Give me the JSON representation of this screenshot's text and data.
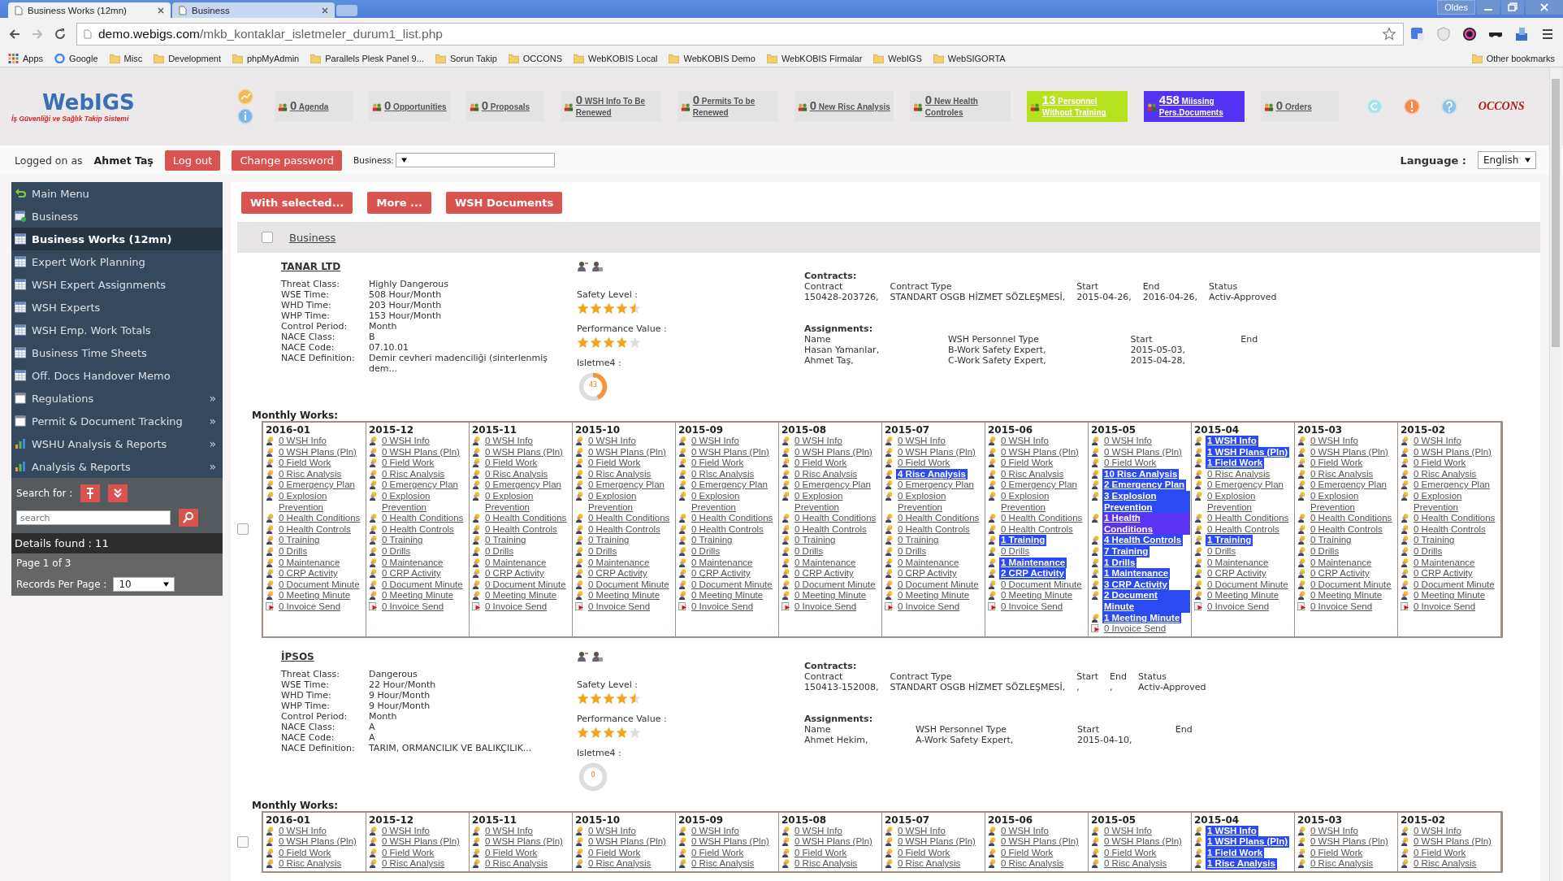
{
  "browser": {
    "tabs": [
      {
        "title": "Business Works (12mn)",
        "selected": true
      },
      {
        "title": "Business",
        "selected": false
      }
    ],
    "profile": "Oldes",
    "url_domain": "demo.webigs.com",
    "url_path": "/mkb_kontaklar_isletmeler_durum1_list.php",
    "bookmarks": [
      "Apps",
      "Google",
      "Misc",
      "Development",
      "phpMyAdmin",
      "Parallels Plesk Panel 9...",
      "Sorun Takip",
      "OCCONS",
      "WebKOBIS Local",
      "WebKOBIS Demo",
      "WebKOBIS Firmalar",
      "WebIGS",
      "WebSIGORTA"
    ],
    "other_bookmarks": "Other bookmarks"
  },
  "logo": {
    "name": "WebIGS",
    "tagline": "İş Güvenliği ve Sağlık Takip Sistemi"
  },
  "widgets": [
    {
      "count": "0",
      "label": "Agenda",
      "color": "#e3e3e3"
    },
    {
      "count": "0",
      "label": "Opportunities",
      "color": "#e3e3e3"
    },
    {
      "count": "0",
      "label": "Proposals",
      "color": "#e3e3e3"
    },
    {
      "count": "0",
      "label": "WSH Info To Be Renewed",
      "color": "#e3e3e3"
    },
    {
      "count": "0",
      "label": "Permits To be Renewed",
      "color": "#e3e3e3"
    },
    {
      "count": "0",
      "label": "New Risc Analysis",
      "color": "#e3e3e3"
    },
    {
      "count": "0",
      "label": "New Health Controles",
      "color": "#e3e3e3"
    },
    {
      "count": "13",
      "label": "Personnel Without Training",
      "color": "#b6e21f"
    },
    {
      "count": "458",
      "label": "Miissing Pers.Documents",
      "color": "#5533f5"
    },
    {
      "count": "0",
      "label": "Orders",
      "color": "#e3e3e3"
    }
  ],
  "partner_logo": "OCCONS",
  "login": {
    "prefix": "Logged on as",
    "user": "Ahmet Taş",
    "logout": "Log out",
    "change_password": "Change password",
    "business_label": "Business:",
    "language_label": "Language :",
    "language": "English"
  },
  "sidebar": {
    "items": [
      {
        "label": "Main Menu",
        "kind": "back",
        "selected": false
      },
      {
        "label": "Business",
        "kind": "add",
        "selected": false
      },
      {
        "label": "Business Works (12mn)",
        "kind": "table",
        "selected": true
      },
      {
        "label": "Expert Work Planning",
        "kind": "table",
        "selected": false
      },
      {
        "label": "WSH Expert Assignments",
        "kind": "table",
        "selected": false
      },
      {
        "label": "WSH Experts",
        "kind": "table",
        "selected": false
      },
      {
        "label": "WSH Emp. Work Totals",
        "kind": "table",
        "selected": false
      },
      {
        "label": "Business Time Sheets",
        "kind": "table",
        "selected": false
      },
      {
        "label": "Off. Docs Handover Memo",
        "kind": "table",
        "selected": false
      },
      {
        "label": "Regulations",
        "kind": "page",
        "selected": false,
        "arrow": "»"
      },
      {
        "label": "Permit & Document Tracking",
        "kind": "page",
        "selected": false,
        "arrow": "»"
      },
      {
        "label": "WSHU Analysis & Reports",
        "kind": "chart",
        "selected": false,
        "arrow": "»"
      },
      {
        "label": "Analysis & Reports",
        "kind": "chart",
        "selected": false,
        "arrow": "»"
      }
    ],
    "search_label": "Search for :",
    "search_placeholder": "search",
    "details": "Details found : 11",
    "page": "Page 1 of 3",
    "per_page_label": "Records Per Page :",
    "per_page": "10"
  },
  "actions": [
    "With selected...",
    "More ...",
    "WSH Documents"
  ],
  "list_header": "Business",
  "list_checked": false,
  "businesses": [
    {
      "name": "TANAR LTD",
      "fields": [
        {
          "label": "Threat Class:",
          "value": "Highly Dangerous"
        },
        {
          "label": "WSE Time:",
          "value": "508 Hour/Month"
        },
        {
          "label": "WHD Time:",
          "value": "203 Hour/Month"
        },
        {
          "label": "WHP Time:",
          "value": "153 Hour/Month"
        },
        {
          "label": "Control Period:",
          "value": "Month"
        },
        {
          "label": "NACE Class:",
          "value": "B"
        },
        {
          "label": "NACE Code:",
          "value": "07.10.01"
        },
        {
          "label": "NACE Definition:",
          "value": "Demir cevheri madenciliği (sinterlenmiş dem..."
        }
      ],
      "safety_label": "Safety Level :",
      "safety": {
        "stars": 4.5
      },
      "performance_label": "Performance Value :",
      "performance": {
        "stars": 4
      },
      "donut_label": "Isletme4 :",
      "donut": {
        "value": "43",
        "level": 0.43
      },
      "contracts": {
        "title": "Contracts:",
        "columns": [
          "Contract",
          "Contract Type",
          "Start",
          "End",
          "Status"
        ],
        "rows": [
          [
            "150428-203726,",
            "STANDART OSGB HİZMET SÖZLEŞMESİ,",
            "2015-04-26,",
            "2016-04-26,",
            "Activ-Approved"
          ]
        ]
      },
      "assignments": {
        "title": "Assignments:",
        "columns": [
          "Name",
          "WSH Personnel Type",
          "Start",
          "End"
        ],
        "rows": [
          [
            "Hasan Yamanlar,",
            "B-Work Safety Expert,",
            "2015-05-03,"
          ],
          [
            "Ahmet Taş,",
            "C-Work Safety Expert,",
            "2015-04-28,"
          ]
        ]
      },
      "works_label": "Monthly Works:",
      "checked": false,
      "months": [
        {
          "label": "2016-01",
          "items": [
            {
              "text": "0 WSH Info",
              "highlighted": false
            },
            {
              "text": "0 WSH Plans (Pln)",
              "highlighted": false
            },
            {
              "text": "0 Field Work",
              "highlighted": false
            },
            {
              "text": "0 Risc Analysis",
              "highlighted": false
            },
            {
              "text": "0 Emergency Plan",
              "highlighted": false
            },
            {
              "text": "0 Explosion Prevention",
              "highlighted": false
            },
            {
              "text": "0 Health Conditions",
              "highlighted": false
            },
            {
              "text": "0 Health Controls",
              "highlighted": false
            },
            {
              "text": "0 Training",
              "highlighted": false
            },
            {
              "text": "0 Drills",
              "highlighted": false
            },
            {
              "text": "0 Maintenance",
              "highlighted": false
            },
            {
              "text": "0 CRP Activity",
              "highlighted": false
            },
            {
              "text": "0 Document Minute",
              "highlighted": false
            },
            {
              "text": "0 Meeting Minute",
              "highlighted": false
            },
            {
              "text": "0 Invoice Send",
              "highlighted": false
            }
          ]
        },
        {
          "label": "2015-12",
          "items": [
            {
              "text": "0 WSH Info",
              "highlighted": false
            },
            {
              "text": "0 WSH Plans (Pln)",
              "highlighted": false
            },
            {
              "text": "0 Field Work",
              "highlighted": false
            },
            {
              "text": "0 Risc Analysis",
              "highlighted": false
            },
            {
              "text": "0 Emergency Plan",
              "highlighted": false
            },
            {
              "text": "0 Explosion Prevention",
              "highlighted": false
            },
            {
              "text": "0 Health Conditions",
              "highlighted": false
            },
            {
              "text": "0 Health Controls",
              "highlighted": false
            },
            {
              "text": "0 Training",
              "highlighted": false
            },
            {
              "text": "0 Drills",
              "highlighted": false
            },
            {
              "text": "0 Maintenance",
              "highlighted": false
            },
            {
              "text": "0 CRP Activity",
              "highlighted": false
            },
            {
              "text": "0 Document Minute",
              "highlighted": false
            },
            {
              "text": "0 Meeting Minute",
              "highlighted": false
            },
            {
              "text": "0 Invoice Send",
              "highlighted": false
            }
          ]
        },
        {
          "label": "2015-11",
          "items": [
            {
              "text": "0 WSH Info",
              "highlighted": false
            },
            {
              "text": "0 WSH Plans (Pln)",
              "highlighted": false
            },
            {
              "text": "0 Field Work",
              "highlighted": false
            },
            {
              "text": "0 Risc Analysis",
              "highlighted": false
            },
            {
              "text": "0 Emergency Plan",
              "highlighted": false
            },
            {
              "text": "0 Explosion Prevention",
              "highlighted": false
            },
            {
              "text": "0 Health Conditions",
              "highlighted": false
            },
            {
              "text": "0 Health Controls",
              "highlighted": false
            },
            {
              "text": "0 Training",
              "highlighted": false
            },
            {
              "text": "0 Drills",
              "highlighted": false
            },
            {
              "text": "0 Maintenance",
              "highlighted": false
            },
            {
              "text": "0 CRP Activity",
              "highlighted": false
            },
            {
              "text": "0 Document Minute",
              "highlighted": false
            },
            {
              "text": "0 Meeting Minute",
              "highlighted": false
            },
            {
              "text": "0 Invoice Send",
              "highlighted": false
            }
          ]
        },
        {
          "label": "2015-10",
          "items": [
            {
              "text": "0 WSH Info",
              "highlighted": false
            },
            {
              "text": "0 WSH Plans (Pln)",
              "highlighted": false
            },
            {
              "text": "0 Field Work",
              "highlighted": false
            },
            {
              "text": "0 Risc Analysis",
              "highlighted": false
            },
            {
              "text": "0 Emergency Plan",
              "highlighted": false
            },
            {
              "text": "0 Explosion Prevention",
              "highlighted": false
            },
            {
              "text": "0 Health Conditions",
              "highlighted": false
            },
            {
              "text": "0 Health Controls",
              "highlighted": false
            },
            {
              "text": "0 Training",
              "highlighted": false
            },
            {
              "text": "0 Drills",
              "highlighted": false
            },
            {
              "text": "0 Maintenance",
              "highlighted": false
            },
            {
              "text": "0 CRP Activity",
              "highlighted": false
            },
            {
              "text": "0 Document Minute",
              "highlighted": false
            },
            {
              "text": "0 Meeting Minute",
              "highlighted": false
            },
            {
              "text": "0 Invoice Send",
              "highlighted": false
            }
          ]
        },
        {
          "label": "2015-09",
          "items": [
            {
              "text": "0 WSH Info",
              "highlighted": false
            },
            {
              "text": "0 WSH Plans (Pln)",
              "highlighted": false
            },
            {
              "text": "0 Field Work",
              "highlighted": false
            },
            {
              "text": "0 Risc Analysis",
              "highlighted": false
            },
            {
              "text": "0 Emergency Plan",
              "highlighted": false
            },
            {
              "text": "0 Explosion Prevention",
              "highlighted": false
            },
            {
              "text": "0 Health Conditions",
              "highlighted": false
            },
            {
              "text": "0 Health Controls",
              "highlighted": false
            },
            {
              "text": "0 Training",
              "highlighted": false
            },
            {
              "text": "0 Drills",
              "highlighted": false
            },
            {
              "text": "0 Maintenance",
              "highlighted": false
            },
            {
              "text": "0 CRP Activity",
              "highlighted": false
            },
            {
              "text": "0 Document Minute",
              "highlighted": false
            },
            {
              "text": "0 Meeting Minute",
              "highlighted": false
            },
            {
              "text": "0 Invoice Send",
              "highlighted": false
            }
          ]
        },
        {
          "label": "2015-08",
          "items": [
            {
              "text": "0 WSH Info",
              "highlighted": false
            },
            {
              "text": "0 WSH Plans (Pln)",
              "highlighted": false
            },
            {
              "text": "0 Field Work",
              "highlighted": false
            },
            {
              "text": "0 Risc Analysis",
              "highlighted": false
            },
            {
              "text": "0 Emergency Plan",
              "highlighted": false
            },
            {
              "text": "0 Explosion Prevention",
              "highlighted": false
            },
            {
              "text": "0 Health Conditions",
              "highlighted": false
            },
            {
              "text": "0 Health Controls",
              "highlighted": false
            },
            {
              "text": "0 Training",
              "highlighted": false
            },
            {
              "text": "0 Drills",
              "highlighted": false
            },
            {
              "text": "0 Maintenance",
              "highlighted": false
            },
            {
              "text": "0 CRP Activity",
              "highlighted": false
            },
            {
              "text": "0 Document Minute",
              "highlighted": false
            },
            {
              "text": "0 Meeting Minute",
              "highlighted": false
            },
            {
              "text": "0 Invoice Send",
              "highlighted": false
            }
          ]
        },
        {
          "label": "2015-07",
          "items": [
            {
              "text": "0 WSH Info",
              "highlighted": false
            },
            {
              "text": "0 WSH Plans (Pln)",
              "highlighted": false
            },
            {
              "text": "0 Field Work",
              "highlighted": false
            },
            {
              "text": "4 Risc Analysis",
              "highlighted": true,
              "color": "#2b4bf2"
            },
            {
              "text": "0 Emergency Plan",
              "highlighted": false
            },
            {
              "text": "0 Explosion Prevention",
              "highlighted": false
            },
            {
              "text": "0 Health Conditions",
              "highlighted": false
            },
            {
              "text": "0 Health Controls",
              "highlighted": false
            },
            {
              "text": "0 Training",
              "highlighted": false
            },
            {
              "text": "0 Drills",
              "highlighted": false
            },
            {
              "text": "0 Maintenance",
              "highlighted": false
            },
            {
              "text": "0 CRP Activity",
              "highlighted": false
            },
            {
              "text": "0 Document Minute",
              "highlighted": false
            },
            {
              "text": "0 Meeting Minute",
              "highlighted": false
            },
            {
              "text": "0 Invoice Send",
              "highlighted": false
            }
          ]
        },
        {
          "label": "2015-06",
          "items": [
            {
              "text": "0 WSH Info",
              "highlighted": false
            },
            {
              "text": "0 WSH Plans (Pln)",
              "highlighted": false
            },
            {
              "text": "0 Field Work",
              "highlighted": false
            },
            {
              "text": "0 Risc Analysis",
              "highlighted": false
            },
            {
              "text": "0 Emergency Plan",
              "highlighted": false
            },
            {
              "text": "0 Explosion Prevention",
              "highlighted": false
            },
            {
              "text": "0 Health Conditions",
              "highlighted": false
            },
            {
              "text": "0 Health Controls",
              "highlighted": false
            },
            {
              "text": "1 Training",
              "highlighted": true,
              "color": "#2b4bf2"
            },
            {
              "text": "0 Drills",
              "highlighted": false
            },
            {
              "text": "1 Maintenance",
              "highlighted": true,
              "color": "#2b4bf2"
            },
            {
              "text": "2 CRP Activity",
              "highlighted": true,
              "color": "#2b4bf2"
            },
            {
              "text": "0 Document Minute",
              "highlighted": false
            },
            {
              "text": "0 Meeting Minute",
              "highlighted": false
            },
            {
              "text": "0 Invoice Send",
              "highlighted": false
            }
          ]
        },
        {
          "label": "2015-05",
          "items": [
            {
              "text": "0 WSH Info",
              "highlighted": false
            },
            {
              "text": "0 WSH Plans (Pln)",
              "highlighted": false
            },
            {
              "text": "0 Field Work",
              "highlighted": false
            },
            {
              "text": "10 Risc Analysis",
              "highlighted": true,
              "color": "#2b4bf2"
            },
            {
              "text": "2 Emergency Plan",
              "highlighted": true,
              "color": "#2b4bf2"
            },
            {
              "text": "3 Explosion Prevention",
              "highlighted": true,
              "color": "#2b4bf2"
            },
            {
              "text": "1 Health Conditions",
              "highlighted": true,
              "color": "#5a34f2"
            },
            {
              "text": "4 Health Controls",
              "highlighted": true,
              "color": "#2b4bf2"
            },
            {
              "text": "7 Training",
              "highlighted": true,
              "color": "#2b4bf2"
            },
            {
              "text": "1 Drills",
              "highlighted": true,
              "color": "#2b4bf2"
            },
            {
              "text": "1 Maintenance",
              "highlighted": true,
              "color": "#2b4bf2"
            },
            {
              "text": "3 CRP Activity",
              "highlighted": true,
              "color": "#2b4bf2"
            },
            {
              "text": "2 Document Minute",
              "highlighted": true,
              "color": "#2b4bf2"
            },
            {
              "text": "1 Meeting Minute",
              "highlighted": true,
              "color": "#2b4bf2"
            },
            {
              "text": "0 Invoice Send",
              "highlighted": false
            }
          ]
        },
        {
          "label": "2015-04",
          "items": [
            {
              "text": "1 WSH Info",
              "highlighted": true,
              "color": "#2b4bf2"
            },
            {
              "text": "1 WSH Plans (Pln)",
              "highlighted": true,
              "color": "#2b4bf2"
            },
            {
              "text": "1 Field Work",
              "highlighted": true,
              "color": "#2b4bf2"
            },
            {
              "text": "0 Risc Analysis",
              "highlighted": false
            },
            {
              "text": "0 Emergency Plan",
              "highlighted": false
            },
            {
              "text": "0 Explosion Prevention",
              "highlighted": false
            },
            {
              "text": "0 Health Conditions",
              "highlighted": false
            },
            {
              "text": "0 Health Controls",
              "highlighted": false
            },
            {
              "text": "1 Training",
              "highlighted": true,
              "color": "#2b4bf2"
            },
            {
              "text": "0 Drills",
              "highlighted": false
            },
            {
              "text": "0 Maintenance",
              "highlighted": false
            },
            {
              "text": "0 CRP Activity",
              "highlighted": false
            },
            {
              "text": "0 Document Minute",
              "highlighted": false
            },
            {
              "text": "0 Meeting Minute",
              "highlighted": false
            },
            {
              "text": "0 Invoice Send",
              "highlighted": false
            }
          ]
        },
        {
          "label": "2015-03",
          "items": [
            {
              "text": "0 WSH Info",
              "highlighted": false
            },
            {
              "text": "0 WSH Plans (Pln)",
              "highlighted": false
            },
            {
              "text": "0 Field Work",
              "highlighted": false
            },
            {
              "text": "0 Risc Analysis",
              "highlighted": false
            },
            {
              "text": "0 Emergency Plan",
              "highlighted": false
            },
            {
              "text": "0 Explosion Prevention",
              "highlighted": false
            },
            {
              "text": "0 Health Conditions",
              "highlighted": false
            },
            {
              "text": "0 Health Controls",
              "highlighted": false
            },
            {
              "text": "0 Training",
              "highlighted": false
            },
            {
              "text": "0 Drills",
              "highlighted": false
            },
            {
              "text": "0 Maintenance",
              "highlighted": false
            },
            {
              "text": "0 CRP Activity",
              "highlighted": false
            },
            {
              "text": "0 Document Minute",
              "highlighted": false
            },
            {
              "text": "0 Meeting Minute",
              "highlighted": false
            },
            {
              "text": "0 Invoice Send",
              "highlighted": false
            }
          ]
        },
        {
          "label": "2015-02",
          "items": [
            {
              "text": "0 WSH Info",
              "highlighted": false
            },
            {
              "text": "0 WSH Plans (Pln)",
              "highlighted": false
            },
            {
              "text": "0 Field Work",
              "highlighted": false
            },
            {
              "text": "0 Risc Analysis",
              "highlighted": false
            },
            {
              "text": "0 Emergency Plan",
              "highlighted": false
            },
            {
              "text": "0 Explosion Prevention",
              "highlighted": false
            },
            {
              "text": "0 Health Conditions",
              "highlighted": false
            },
            {
              "text": "0 Health Controls",
              "highlighted": false
            },
            {
              "text": "0 Training",
              "highlighted": false
            },
            {
              "text": "0 Drills",
              "highlighted": false
            },
            {
              "text": "0 Maintenance",
              "highlighted": false
            },
            {
              "text": "0 CRP Activity",
              "highlighted": false
            },
            {
              "text": "0 Document Minute",
              "highlighted": false
            },
            {
              "text": "0 Meeting Minute",
              "highlighted": false
            },
            {
              "text": "0 Invoice Send",
              "highlighted": false
            }
          ]
        }
      ]
    },
    {
      "name": "İPSOS",
      "fields": [
        {
          "label": "Threat Class:",
          "value": "Dangerous"
        },
        {
          "label": "WSE Time:",
          "value": "22 Hour/Month"
        },
        {
          "label": "WHD Time:",
          "value": "9 Hour/Month"
        },
        {
          "label": "WHP Time:",
          "value": "9 Hour/Month"
        },
        {
          "label": "Control Period:",
          "value": "Month"
        },
        {
          "label": "NACE Class:",
          "value": "A"
        },
        {
          "label": "NACE Code:",
          "value": "A"
        },
        {
          "label": "NACE Definition:",
          "value": "TARIM, ORMANCILIK VE BALIKÇILIK..."
        }
      ],
      "safety_label": "Safety Level :",
      "safety": {
        "stars": 4.5
      },
      "performance_label": "Performance Value :",
      "performance": {
        "stars": 4
      },
      "donut_label": "Isletme4 :",
      "donut": {
        "value": "0",
        "level": 0
      },
      "contracts": {
        "title": "Contracts:",
        "columns": [
          "Contract",
          "Contract Type",
          "Start",
          "End",
          "Status"
        ],
        "rows": [
          [
            "150413-152008,",
            "STANDART OSGB HİZMET SÖZLEŞMESİ,",
            ",",
            ",",
            "Activ-Approved"
          ]
        ]
      },
      "assignments": {
        "title": "Assignments:",
        "columns": [
          "Name",
          "WSH Personnel Type",
          "Start",
          "End"
        ],
        "rows": [
          [
            "Ahmet Hekim,",
            "A-Work Safety Expert,",
            "2015-04-10,"
          ]
        ]
      },
      "works_label": "Monthly Works:",
      "checked": false,
      "months": [
        {
          "label": "2016-01",
          "items": [
            {
              "text": "0 WSH Info",
              "highlighted": false
            },
            {
              "text": "0 WSH Plans (Pln)",
              "highlighted": false
            },
            {
              "text": "0 Field Work",
              "highlighted": false
            },
            {
              "text": "0 Risc Analysis",
              "highlighted": false
            }
          ]
        },
        {
          "label": "2015-12",
          "items": [
            {
              "text": "0 WSH Info",
              "highlighted": false
            },
            {
              "text": "0 WSH Plans (Pln)",
              "highlighted": false
            },
            {
              "text": "0 Field Work",
              "highlighted": false
            },
            {
              "text": "0 Risc Analysis",
              "highlighted": false
            }
          ]
        },
        {
          "label": "2015-11",
          "items": [
            {
              "text": "0 WSH Info",
              "highlighted": false
            },
            {
              "text": "0 WSH Plans (Pln)",
              "highlighted": false
            },
            {
              "text": "0 Field Work",
              "highlighted": false
            },
            {
              "text": "0 Risc Analysis",
              "highlighted": false
            }
          ]
        },
        {
          "label": "2015-10",
          "items": [
            {
              "text": "0 WSH Info",
              "highlighted": false
            },
            {
              "text": "0 WSH Plans (Pln)",
              "highlighted": false
            },
            {
              "text": "0 Field Work",
              "highlighted": false
            },
            {
              "text": "0 Risc Analysis",
              "highlighted": false
            }
          ]
        },
        {
          "label": "2015-09",
          "items": [
            {
              "text": "0 WSH Info",
              "highlighted": false
            },
            {
              "text": "0 WSH Plans (Pln)",
              "highlighted": false
            },
            {
              "text": "0 Field Work",
              "highlighted": false
            },
            {
              "text": "0 Risc Analysis",
              "highlighted": false
            }
          ]
        },
        {
          "label": "2015-08",
          "items": [
            {
              "text": "0 WSH Info",
              "highlighted": false
            },
            {
              "text": "0 WSH Plans (Pln)",
              "highlighted": false
            },
            {
              "text": "0 Field Work",
              "highlighted": false
            },
            {
              "text": "0 Risc Analysis",
              "highlighted": false
            }
          ]
        },
        {
          "label": "2015-07",
          "items": [
            {
              "text": "0 WSH Info",
              "highlighted": false
            },
            {
              "text": "0 WSH Plans (Pln)",
              "highlighted": false
            },
            {
              "text": "0 Field Work",
              "highlighted": false
            },
            {
              "text": "0 Risc Analysis",
              "highlighted": false
            }
          ]
        },
        {
          "label": "2015-06",
          "items": [
            {
              "text": "0 WSH Info",
              "highlighted": false
            },
            {
              "text": "0 WSH Plans (Pln)",
              "highlighted": false
            },
            {
              "text": "0 Field Work",
              "highlighted": false
            },
            {
              "text": "0 Risc Analysis",
              "highlighted": false
            }
          ]
        },
        {
          "label": "2015-05",
          "items": [
            {
              "text": "0 WSH Info",
              "highlighted": false
            },
            {
              "text": "0 WSH Plans (Pln)",
              "highlighted": false
            },
            {
              "text": "0 Field Work",
              "highlighted": false
            },
            {
              "text": "0 Risc Analysis",
              "highlighted": false
            }
          ]
        },
        {
          "label": "2015-04",
          "items": [
            {
              "text": "1 WSH Info",
              "highlighted": true,
              "color": "#2b4bf2"
            },
            {
              "text": "1 WSH Plans (Pln)",
              "highlighted": true,
              "color": "#2b4bf2"
            },
            {
              "text": "1 Field Work",
              "highlighted": true,
              "color": "#2b4bf2"
            },
            {
              "text": "1 Risc Analysis",
              "highlighted": true,
              "color": "#2b4bf2"
            }
          ]
        },
        {
          "label": "2015-03",
          "items": [
            {
              "text": "0 WSH Info",
              "highlighted": false
            },
            {
              "text": "0 WSH Plans (Pln)",
              "highlighted": false
            },
            {
              "text": "0 Field Work",
              "highlighted": false
            },
            {
              "text": "0 Risc Analysis",
              "highlighted": false
            }
          ]
        },
        {
          "label": "2015-02",
          "items": [
            {
              "text": "0 WSH Info",
              "highlighted": false
            },
            {
              "text": "0 WSH Plans (Pln)",
              "highlighted": false
            },
            {
              "text": "0 Field Work",
              "highlighted": false
            },
            {
              "text": "0 Risc Analysis",
              "highlighted": false
            }
          ]
        }
      ]
    }
  ]
}
